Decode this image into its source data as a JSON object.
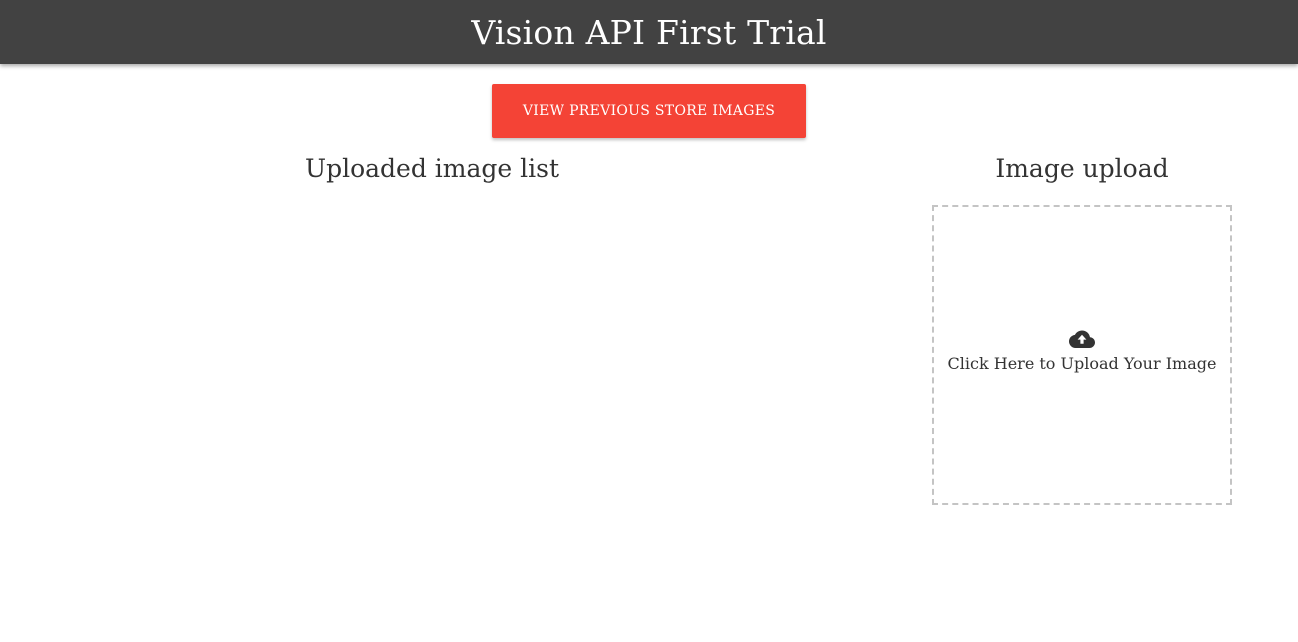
{
  "header": {
    "title": "Vision API First Trial",
    "background": "#424242"
  },
  "actions": {
    "view_previous_label": "VIEW PREVIOUS STORE IMAGES",
    "button_color": "#f44336"
  },
  "image_list": {
    "title": "Uploaded image list",
    "items": []
  },
  "image_upload": {
    "title": "Image upload",
    "icon": "cloud-upload-icon",
    "prompt": "Click Here to Upload Your Image"
  }
}
